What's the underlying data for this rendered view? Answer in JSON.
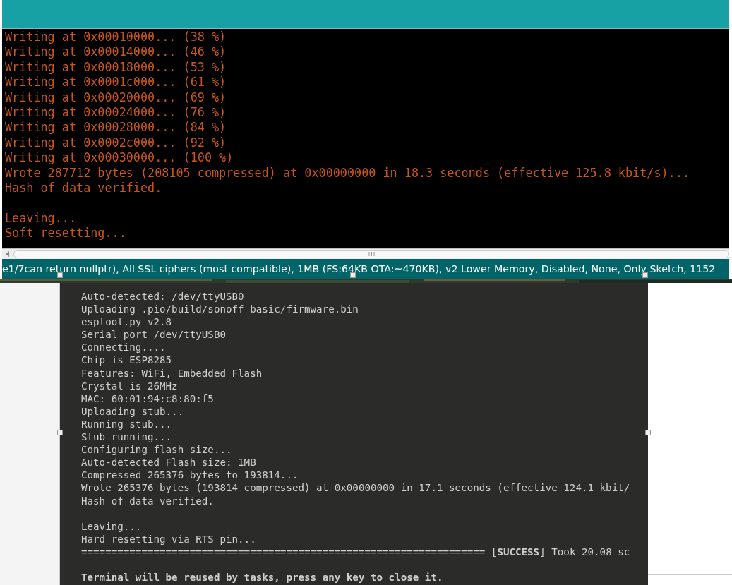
{
  "console": {
    "lines": [
      {
        "text": "Writing at 0x00010000... (38 %)"
      },
      {
        "text": "Writing at 0x00014000... (46 %)"
      },
      {
        "text": "Writing at 0x00018000... (53 %)"
      },
      {
        "text": "Writing at 0x0001c000... (61 %)"
      },
      {
        "text": "Writing at 0x00020000... (69 %)"
      },
      {
        "text": "Writing at 0x00024000... (76 %)"
      },
      {
        "text": "Writing at 0x00028000... (84 %)"
      },
      {
        "text": "Writing at 0x0002c000... (92 %)"
      },
      {
        "text": "Writing at 0x00030000... (100 %)"
      },
      {
        "text": "Wrote 287712 bytes (208105 compressed) at 0x00000000 in 18.3 seconds (effective 125.8 kbit/s)..."
      },
      {
        "text": "Hash of data verified."
      },
      {
        "text": "Leaving...",
        "space_before": true
      },
      {
        "text": "Soft resetting..."
      }
    ]
  },
  "status_bar": {
    "text": "e1/7can return nullptr), All SSL ciphers (most compatible), 1MB (FS:64KB OTA:~470KB), v2 Lower Memory, Disabled, None, Only Sketch, 1152"
  },
  "terminal": {
    "lines": [
      {
        "kind": "plain",
        "text": "Auto-detected: /dev/ttyUSB0"
      },
      {
        "kind": "plain",
        "text": "Uploading .pio/build/sonoff_basic/firmware.bin"
      },
      {
        "kind": "plain",
        "text": "esptool.py v2.8"
      },
      {
        "kind": "plain",
        "text": "Serial port /dev/ttyUSB0"
      },
      {
        "kind": "plain",
        "text": "Connecting...."
      },
      {
        "kind": "plain",
        "text": "Chip is ESP8285"
      },
      {
        "kind": "plain",
        "text": "Features: WiFi, Embedded Flash"
      },
      {
        "kind": "plain",
        "text": "Crystal is 26MHz"
      },
      {
        "kind": "plain",
        "text": "MAC: 60:01:94:c8:80:f5"
      },
      {
        "kind": "plain",
        "text": "Uploading stub..."
      },
      {
        "kind": "plain",
        "text": "Running stub..."
      },
      {
        "kind": "plain",
        "text": "Stub running..."
      },
      {
        "kind": "plain",
        "text": "Configuring flash size..."
      },
      {
        "kind": "plain",
        "text": "Auto-detected Flash size: 1MB"
      },
      {
        "kind": "plain",
        "text": "Compressed 265376 bytes to 193814..."
      },
      {
        "kind": "plain",
        "text": "Wrote 265376 bytes (193814 compressed) at 0x00000000 in 17.1 seconds (effective 124.1 kbit/"
      },
      {
        "kind": "plain",
        "text": "Hash of data verified."
      },
      {
        "kind": "blank"
      },
      {
        "kind": "plain",
        "text": "Leaving..."
      },
      {
        "kind": "plain",
        "text": "Hard resetting via RTS pin..."
      },
      {
        "kind": "result",
        "text": "=================================================================== [**SUCCESS**] Took 20.08 sc"
      },
      {
        "kind": "blank"
      },
      {
        "kind": "notice",
        "text": "Terminal will be reused by tasks, press any key to close it."
      }
    ]
  }
}
